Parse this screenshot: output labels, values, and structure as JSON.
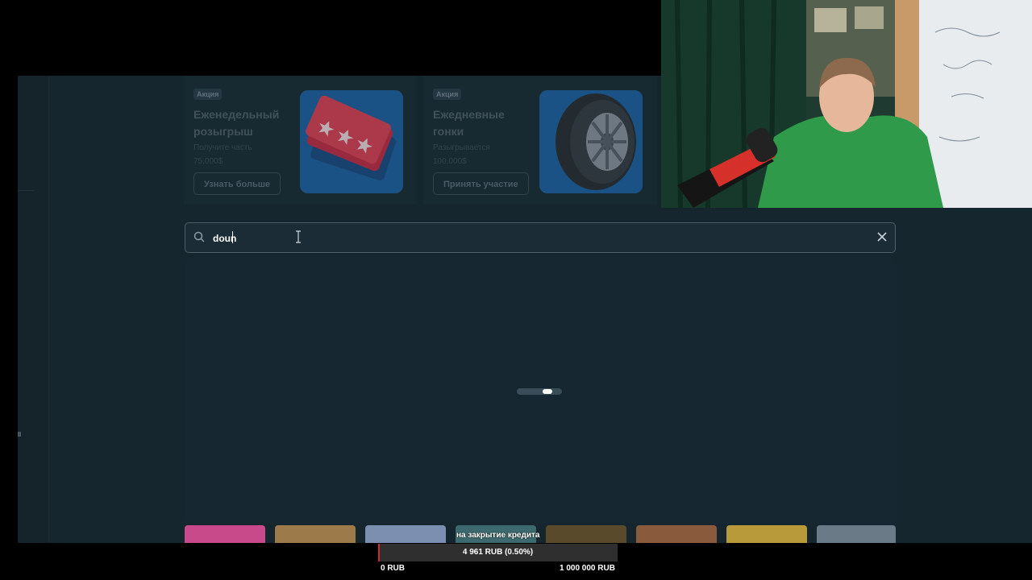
{
  "promos": [
    {
      "badge": "Акция",
      "title": "Еженедельный розыгрыш",
      "subtitle": "Получите часть",
      "amount": "75.000$",
      "button": "Узнать больше",
      "icon": "tickets-icon"
    },
    {
      "badge": "Акция",
      "title": "Ежедневные гонки",
      "subtitle": "Разыгрывается",
      "amount": "100.000$",
      "button": "Принять участие",
      "icon": "tire-icon"
    }
  ],
  "search": {
    "value": "doun",
    "placeholder": ""
  },
  "results": {
    "state": "loading"
  },
  "credit": {
    "label": "на закрытие кредита",
    "value_text": "4 961 RUB (0.50%)",
    "progress_percent": 0.5,
    "min_label": "0 RUB",
    "max_label": "1 000 000 RUB",
    "fill_color": "#d42a2a"
  },
  "colors": {
    "background": "#1a2b35",
    "accent": "#ffffff"
  }
}
